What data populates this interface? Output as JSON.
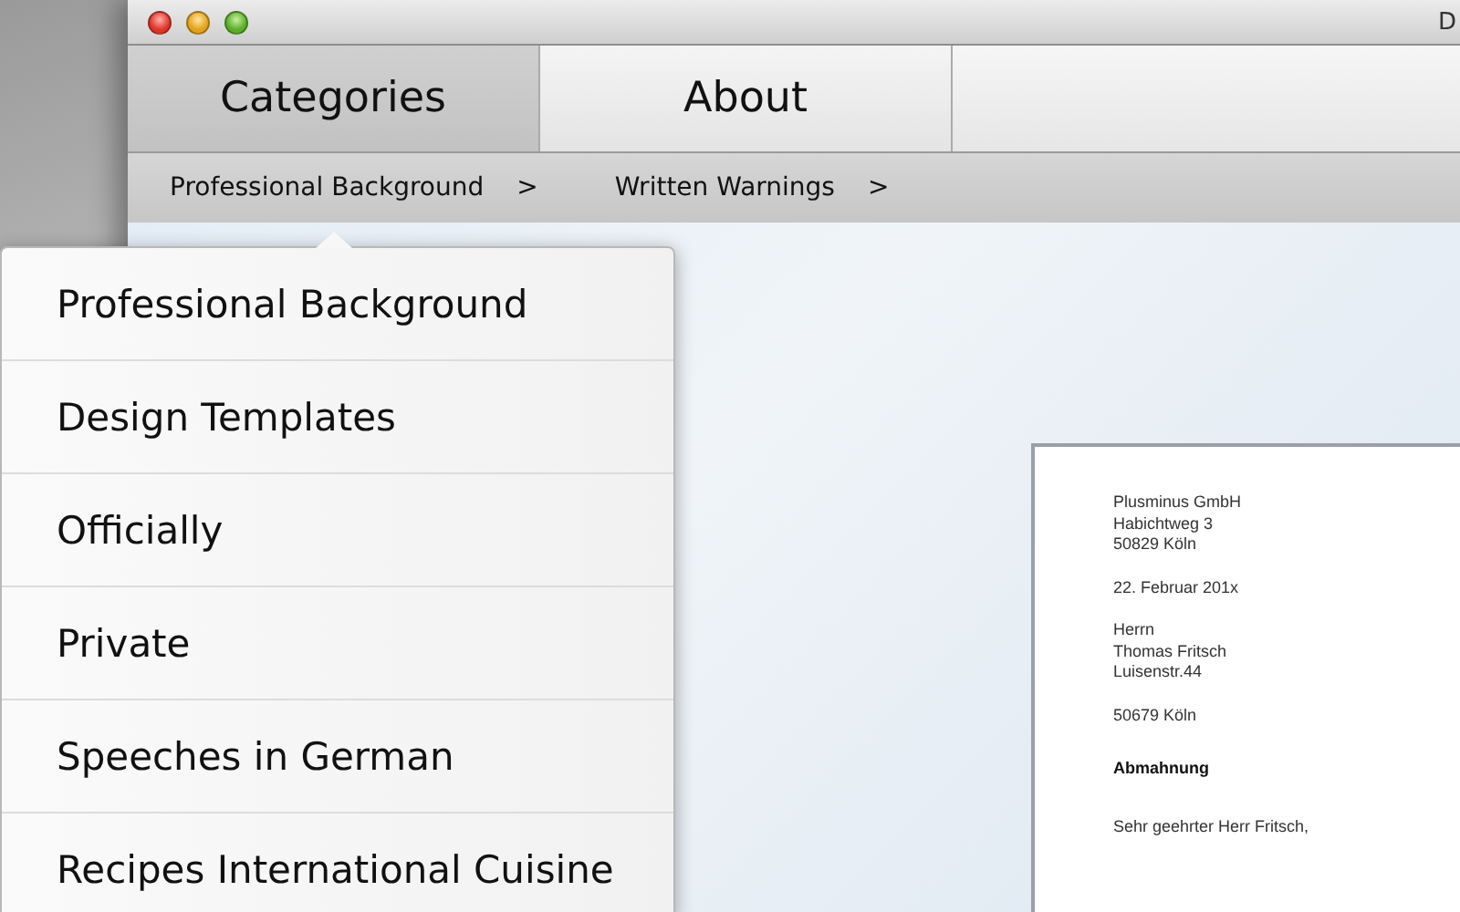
{
  "window": {
    "title": "D"
  },
  "tabs": [
    {
      "label": "Categories",
      "selected": true
    },
    {
      "label": "About",
      "selected": false
    }
  ],
  "breadcrumbs": [
    {
      "label": "Professional Background",
      "separator": ">"
    },
    {
      "label": "Written Warnings",
      "separator": ">"
    }
  ],
  "menu": {
    "items": [
      {
        "label": "Professional Background"
      },
      {
        "label": "Design Templates"
      },
      {
        "label": "Officially"
      },
      {
        "label": "Private"
      },
      {
        "label": "Speeches in German"
      },
      {
        "label": "Recipes International Cuisine"
      }
    ]
  },
  "letter": {
    "blocks": [
      {
        "kind": "address",
        "lines": [
          "Plusminus GmbH",
          "Habichtweg 3",
          "50829 Köln"
        ]
      },
      {
        "kind": "address",
        "lines": [
          "22. Februar 201x"
        ]
      },
      {
        "kind": "address",
        "lines": [
          "Herrn",
          "Thomas Fritsch",
          "Luisenstr.44"
        ]
      },
      {
        "kind": "address",
        "lines": [
          "50679 Köln"
        ]
      },
      {
        "kind": "subject",
        "lines": [
          "Abmahnung"
        ]
      },
      {
        "kind": "address",
        "lines": [
          "Sehr geehrter Herr Fritsch,"
        ]
      }
    ]
  }
}
